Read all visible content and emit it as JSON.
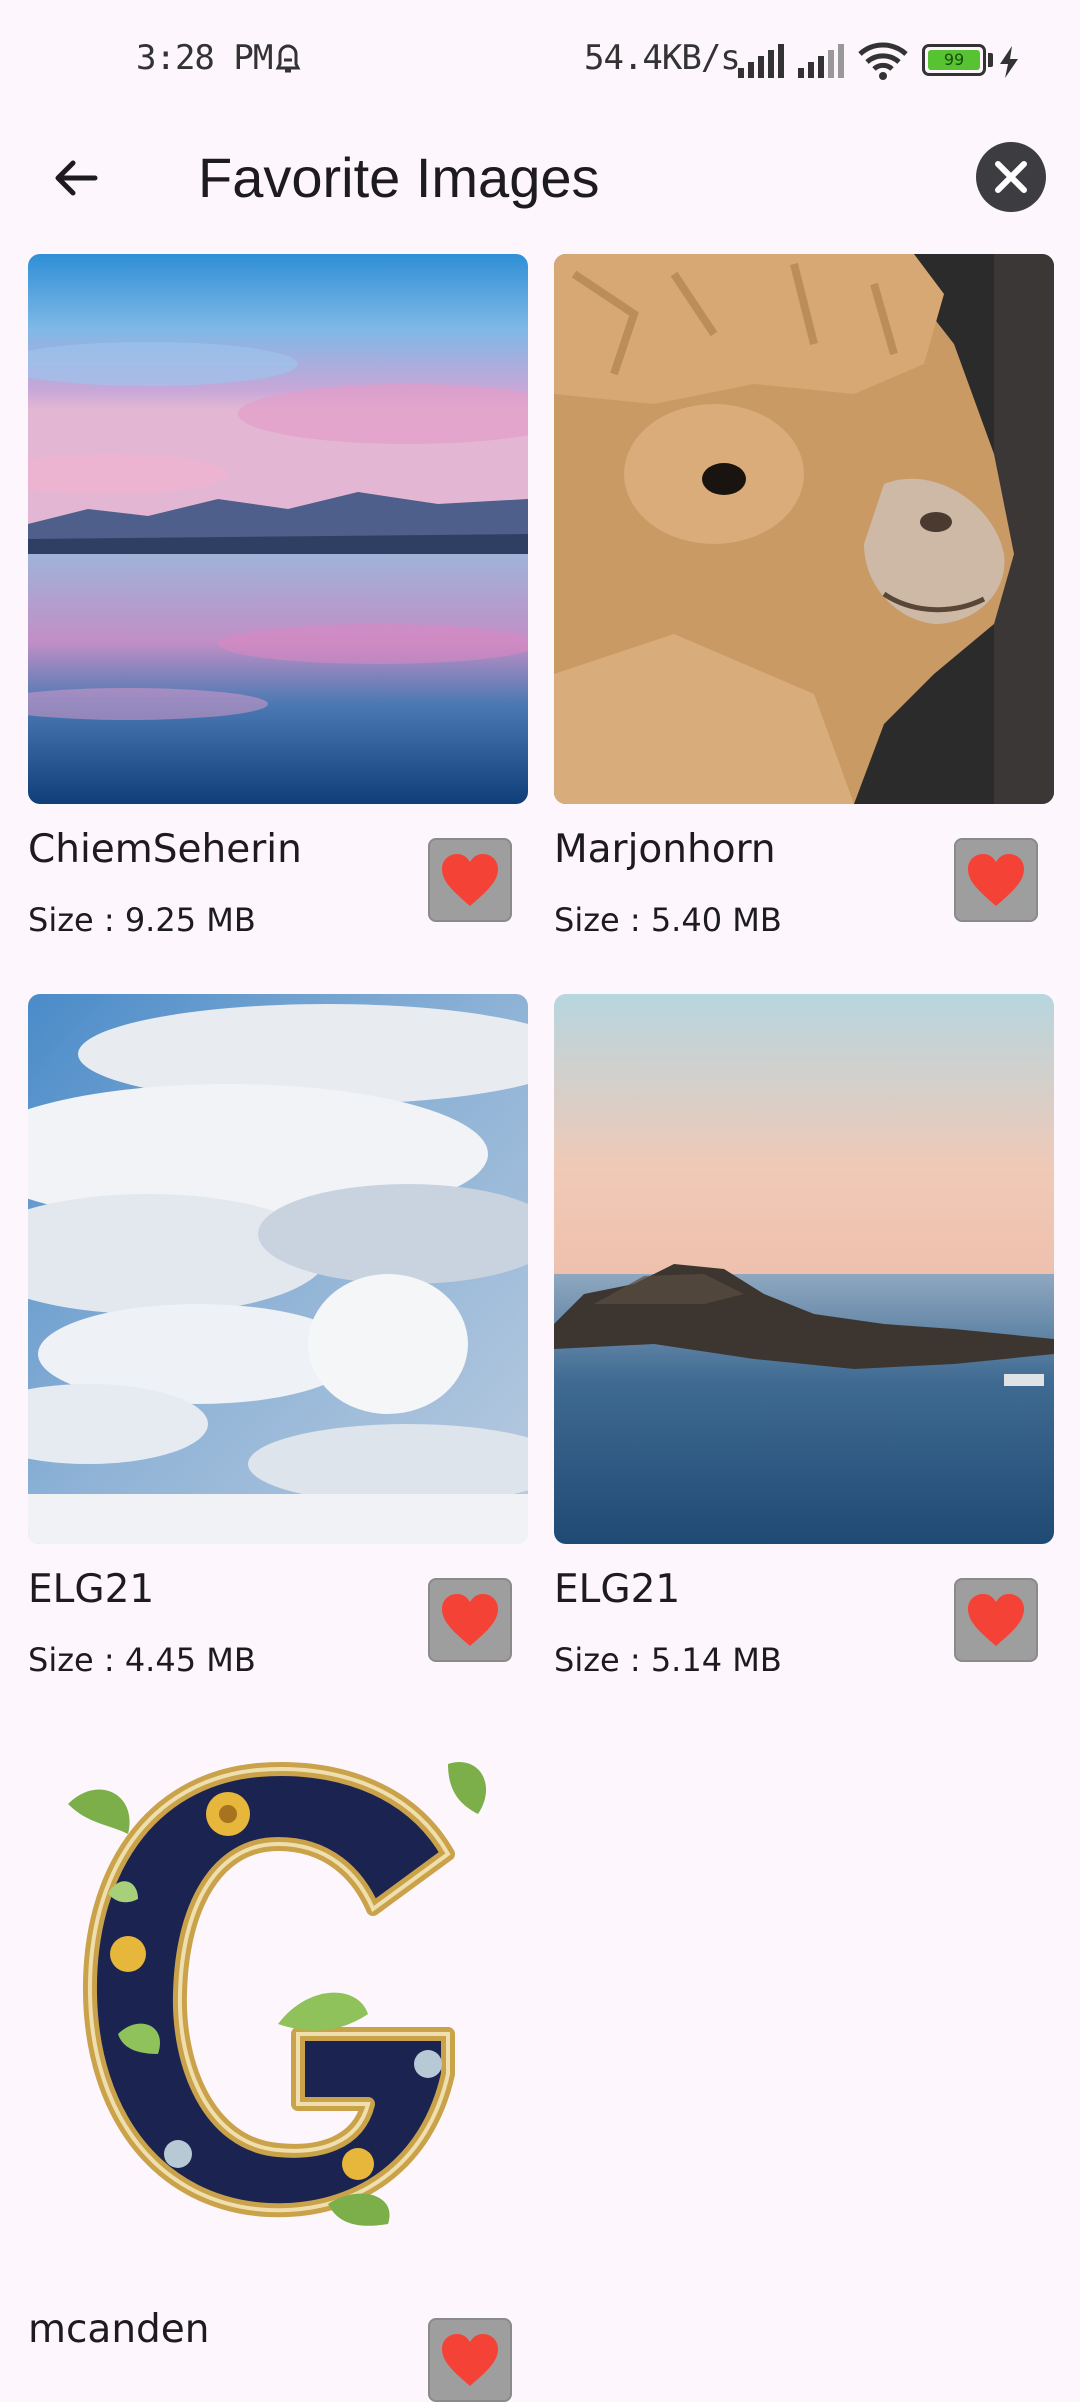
{
  "status_bar": {
    "time": "3:28 PM",
    "speed": "54.4KB/s",
    "battery": "99",
    "icons": [
      "alarm-icon",
      "signal-icon",
      "signal-icon",
      "wifi-icon",
      "battery-icon",
      "charging-icon"
    ]
  },
  "app_bar": {
    "title": "Favorite Images",
    "back_icon": "arrow-left-icon",
    "close_icon": "close-circle-icon"
  },
  "colors": {
    "background": "#fdf7fd",
    "heart": "#f44336",
    "favorite_button_bg": "#9e9e9e",
    "close_button_bg": "#3d3d41"
  },
  "favorites": [
    {
      "name": "ChiemSeherin",
      "size": "Size : 9.25 MB",
      "image": "lake-sunset-photo"
    },
    {
      "name": "Marjonhorn",
      "size": "Size : 5.40 MB",
      "image": "alpaca-photo"
    },
    {
      "name": "ELG21",
      "size": "Size : 4.45 MB",
      "image": "clouds-sky-photo"
    },
    {
      "name": "ELG21",
      "size": "Size : 5.14 MB",
      "image": "coast-island-photo"
    },
    {
      "name": "mcanden",
      "size": "",
      "image": "ornate-letter-g-image"
    }
  ]
}
